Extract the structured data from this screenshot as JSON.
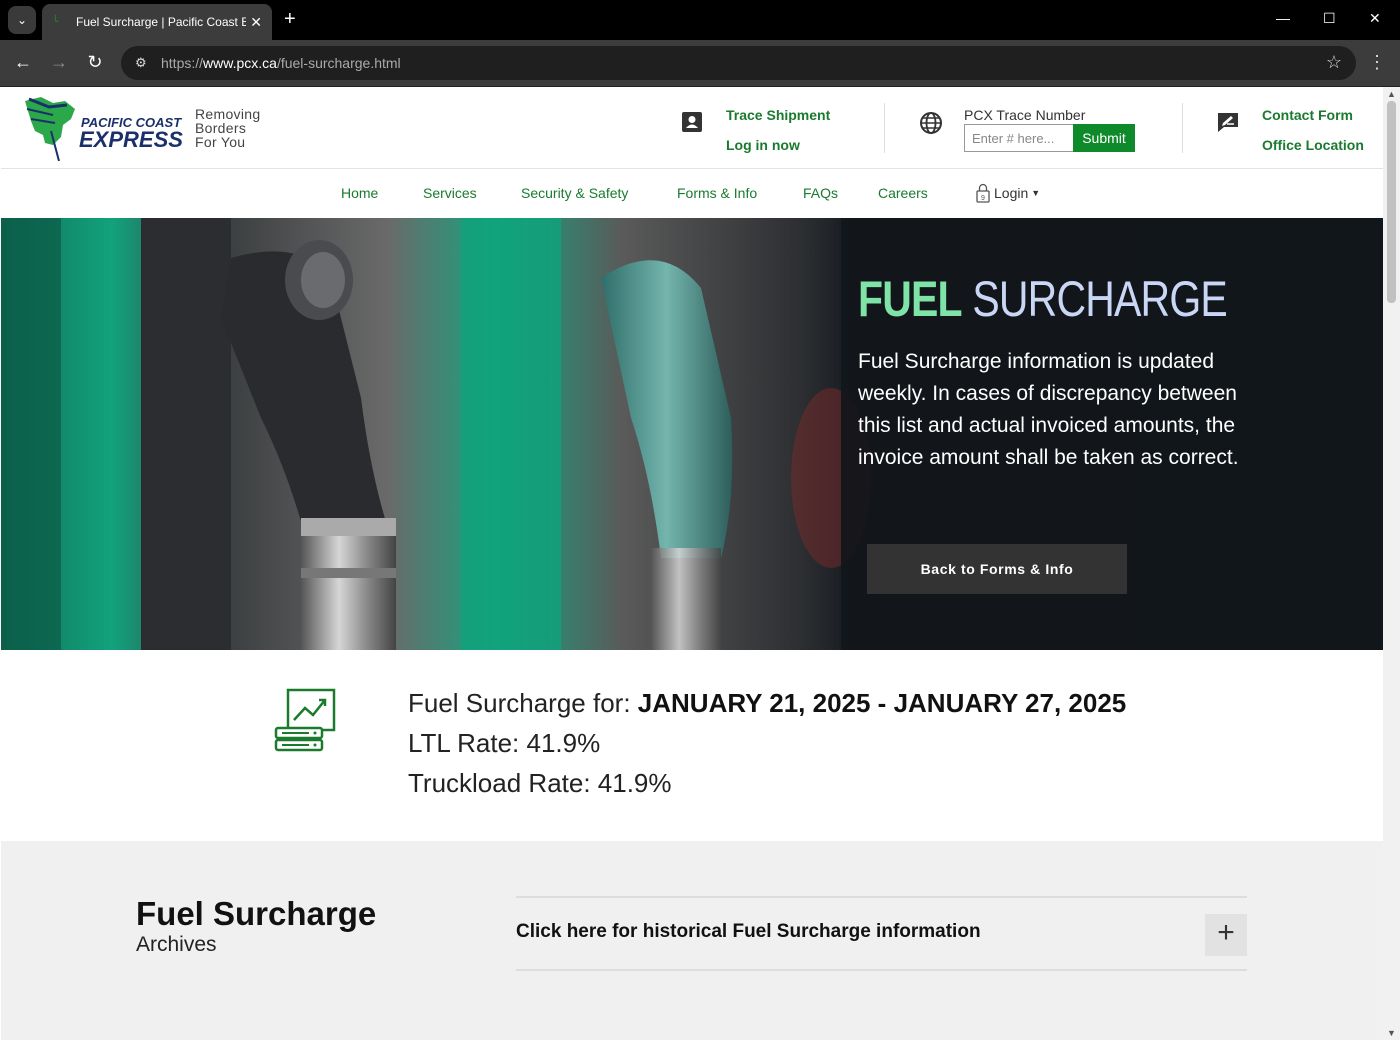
{
  "browser": {
    "tab_title": "Fuel Surcharge | Pacific Coast E",
    "url_prefix": "https://",
    "url_domain": "www.pcx.ca",
    "url_path": "/fuel-surcharge.html"
  },
  "header": {
    "logo_line1": "PACIFIC COAST",
    "logo_line2": "EXPRESS",
    "tagline": [
      "Removing",
      "Borders",
      "For You"
    ],
    "trace_shipment": "Trace Shipment",
    "log_in_now": "Log in now",
    "trace_label": "PCX Trace Number",
    "trace_placeholder": "Enter # here...",
    "submit": "Submit",
    "contact_form": "Contact Form",
    "office_location": "Office Location"
  },
  "nav": {
    "items": [
      "Home",
      "Services",
      "Security & Safety",
      "Forms & Info",
      "FAQs",
      "Careers"
    ],
    "login": "Login"
  },
  "hero": {
    "title_bold": "FUEL",
    "title_light": "SURCHARGE",
    "description": "Fuel Surcharge information is updated weekly. In cases of discrepancy between this list and actual invoiced amounts, the invoice amount shall be taken as correct.",
    "button": "Back to Forms & Info"
  },
  "current": {
    "period_label": "Fuel Surcharge for: ",
    "period_value": "JANUARY 21, 2025 - JANUARY 27, 2025",
    "ltl": "LTL Rate: 41.9%",
    "truckload": "Truckload Rate: 41.9%"
  },
  "archives": {
    "title": "Fuel Surcharge",
    "subtitle": "Archives",
    "accordion_label": "Click here for historical Fuel Surcharge information"
  },
  "colors": {
    "brand_green": "#1a7a2e",
    "submit_green": "#0e8a2a",
    "hero_title_green": "#7fe3a7",
    "hero_title_lavender": "#c9d6f5"
  }
}
